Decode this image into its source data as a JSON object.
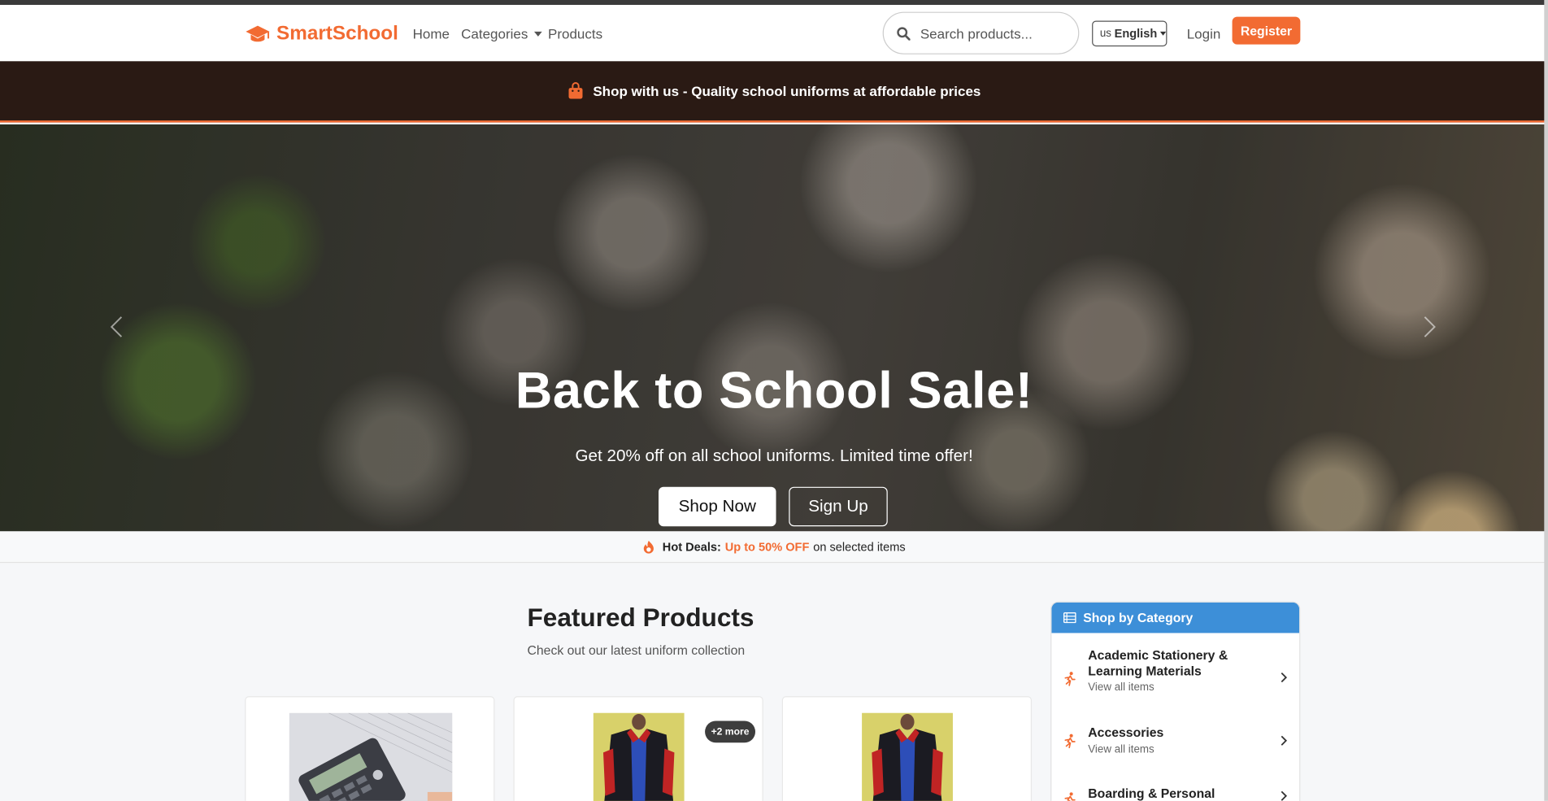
{
  "brand": {
    "name": "SmartSchool",
    "color": "#f26b32"
  },
  "nav": {
    "home": "Home",
    "categories": "Categories",
    "products": "Products"
  },
  "search": {
    "placeholder": "Search products..."
  },
  "language": {
    "flag": "us",
    "label": "English"
  },
  "auth": {
    "login": "Login",
    "register": "Register"
  },
  "announcement": {
    "text": "Shop with us - Quality school uniforms at affordable prices"
  },
  "hero": {
    "title": "Back to School Sale!",
    "subtitle": "Get 20% off on all school uniforms. Limited time offer!",
    "primary_button": "Shop Now",
    "secondary_button": "Sign Up"
  },
  "deals": {
    "label": "Hot Deals:",
    "highlight": "Up to 50% OFF",
    "tail": "on selected items"
  },
  "featured": {
    "title": "Featured Products",
    "subtitle": "Check out our latest uniform collection",
    "cards": [
      {
        "image": "calculator-photo"
      },
      {
        "image": "school-jacket-photo",
        "badge": "+2 more"
      },
      {
        "image": "school-jacket-photo"
      }
    ]
  },
  "categories_panel": {
    "title": "Shop by Category",
    "items": [
      {
        "name": "Academic Stationery & Learning Materials",
        "sub": "View all items"
      },
      {
        "name": "Accessories",
        "sub": "View all items"
      },
      {
        "name": "Boarding & Personal Essentials",
        "sub": ""
      }
    ]
  },
  "colors": {
    "accent": "#f26b32",
    "announce_bg": "#2a1a14",
    "category_header": "#3d8fd8"
  }
}
